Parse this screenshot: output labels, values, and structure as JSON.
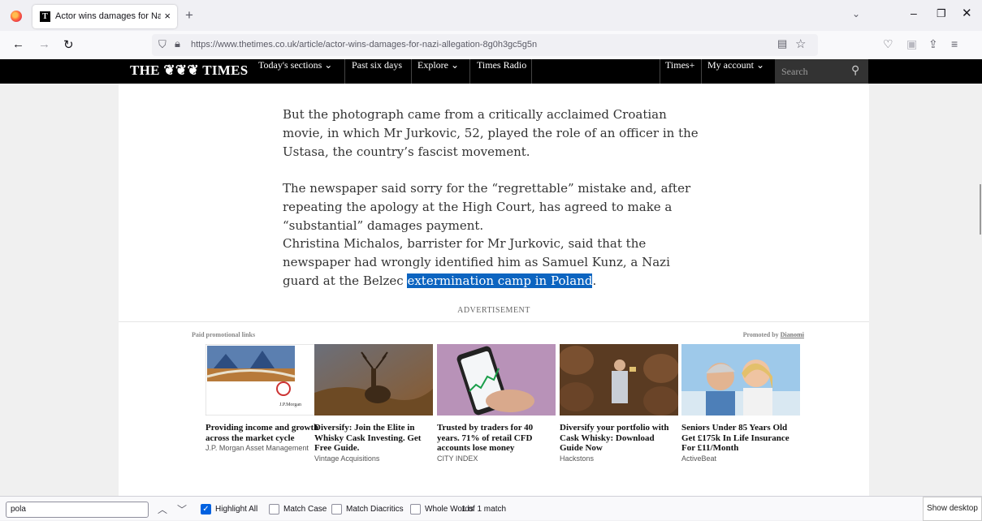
{
  "browser": {
    "tab": {
      "title": "Actor wins damages for Nazi allegation",
      "favicon_letter": "T",
      "close": "×"
    },
    "new_tab": "+",
    "url_host": "https://www.thetimes.co.uk",
    "url_path": "/article/actor-wins-damages-for-nazi-allegation-8g0h3gc5g5n",
    "icons": [
      "firefox-icon",
      "back-icon",
      "forward-icon",
      "reload-icon",
      "shield-icon",
      "lock-icon",
      "reader-view-icon",
      "bookmark-star-icon",
      "pocket-icon",
      "extensions-icon",
      "share-icon",
      "menu-icon"
    ]
  },
  "site": {
    "logo": "THE ❦❦❦ TIMES",
    "nav": {
      "todays_sections": "Today's sections ⌄",
      "past_six_days": "Past six days",
      "explore": "Explore ⌄",
      "times_radio": "Times Radio",
      "times_plus": "Times+",
      "my_account": "My account ⌄"
    },
    "search_placeholder": "Search"
  },
  "article": {
    "p1": "But the photograph came from a critically acclaimed Croatian movie, in which Mr Jurkovic, 52, played the role of an officer in the Ustasa, the country’s fascist movement.",
    "p2": "The newspaper said sorry for the “regrettable” mistake and, after repeating the apology at the High Court, has agreed to make a “substantial” damages payment.",
    "p3_before": "Christina Michalos, barrister for Mr Jurkovic, said that the newspaper had wrongly identified him as Samuel Kunz, a Nazi guard at the Belzec ",
    "p3_highlight": "extermination camp in Poland",
    "p3_after": "."
  },
  "promo": {
    "advert_label": "ADVERTISEMENT",
    "paid_label": "Paid promotional links",
    "promoted_by": "Promoted by",
    "promoter": "Dianomi",
    "cards": [
      {
        "title": "Providing income and growth across the market cycle",
        "source": "J.P. Morgan Asset Management",
        "logo": "J.P.Morgan"
      },
      {
        "title": "Diversify: Join the Elite in Whisky Cask Investing. Get Free Guide.",
        "source": "Vintage Acquisitions"
      },
      {
        "title": "Trusted by traders for 40 years. 71% of retail CFD accounts lose money",
        "source": "CITY INDEX"
      },
      {
        "title": "Diversify your portfolio with Cask Whisky: Download Guide Now",
        "source": "Hackstons"
      },
      {
        "title": "Seniors Under 85 Years Old Get £175k In Life Insurance For £11/Month",
        "source": "ActiveBeat"
      }
    ]
  },
  "findbar": {
    "query": "pola",
    "highlight_all": "Highlight All",
    "match_case": "Match Case",
    "match_diacritics": "Match Diacritics",
    "whole_words": "Whole Words",
    "status": "1 of 1 match",
    "highlight_all_checked": true
  },
  "taskbar": {
    "show_desktop": "Show desktop"
  }
}
